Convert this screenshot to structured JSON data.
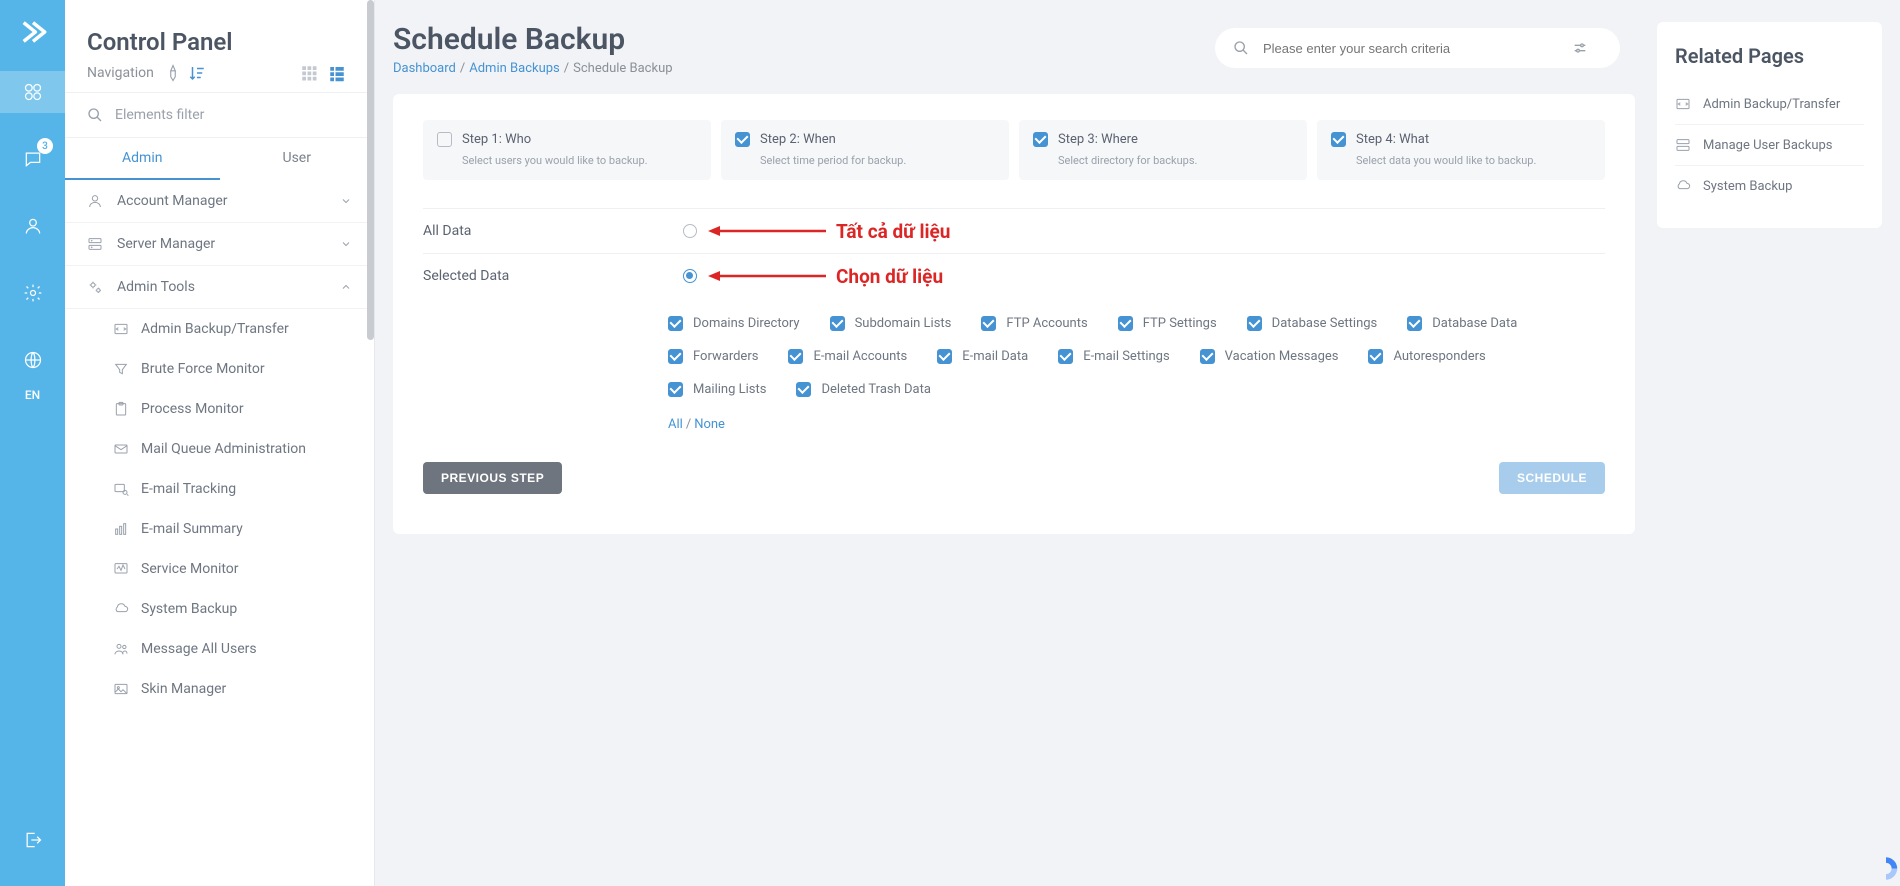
{
  "rail": {
    "lang": "EN",
    "badge": "3"
  },
  "sidebar": {
    "title": "Control Panel",
    "nav_label": "Navigation",
    "filter_placeholder": "Elements filter",
    "tabs": {
      "admin": "Admin",
      "user": "User"
    },
    "items": {
      "account_manager": "Account Manager",
      "server_manager": "Server Manager",
      "admin_tools": "Admin Tools"
    },
    "sub": {
      "admin_backup": "Admin Backup/Transfer",
      "brute_force": "Brute Force Monitor",
      "process_monitor": "Process Monitor",
      "mail_queue": "Mail Queue Administration",
      "email_tracking": "E-mail Tracking",
      "email_summary": "E-mail Summary",
      "service_monitor": "Service Monitor",
      "system_backup": "System Backup",
      "message_all": "Message All Users",
      "skin_manager": "Skin Manager"
    }
  },
  "header": {
    "title": "Schedule Backup",
    "breadcrumb": {
      "dashboard": "Dashboard",
      "admin_backups": "Admin Backups",
      "current": "Schedule Backup"
    },
    "search_placeholder": "Please enter your search criteria"
  },
  "steps": [
    {
      "title": "Step 1: Who",
      "desc": "Select users you would like to backup.",
      "checked": false
    },
    {
      "title": "Step 2: When",
      "desc": "Select time period for backup.",
      "checked": true
    },
    {
      "title": "Step 3: Where",
      "desc": "Select directory for backups.",
      "checked": true
    },
    {
      "title": "Step 4: What",
      "desc": "Select data you would like to backup.",
      "checked": true
    }
  ],
  "radios": {
    "all_data": "All Data",
    "selected_data": "Selected Data"
  },
  "annotations": {
    "all_data": "Tất cả dữ liệu",
    "selected_data": "Chọn dữ liệu"
  },
  "data_options": [
    "Domains Directory",
    "Subdomain Lists",
    "FTP Accounts",
    "FTP Settings",
    "Database Settings",
    "Database Data",
    "Forwarders",
    "E-mail Accounts",
    "E-mail Data",
    "E-mail Settings",
    "Vacation Messages",
    "Autoresponders",
    "Mailing Lists",
    "Deleted Trash Data"
  ],
  "allnone": {
    "all": "All",
    "none": "None"
  },
  "buttons": {
    "prev": "PREVIOUS STEP",
    "schedule": "SCHEDULE"
  },
  "related": {
    "title": "Related Pages",
    "items": {
      "admin_backup": "Admin Backup/Transfer",
      "manage_user": "Manage User Backups",
      "system_backup": "System Backup"
    }
  }
}
